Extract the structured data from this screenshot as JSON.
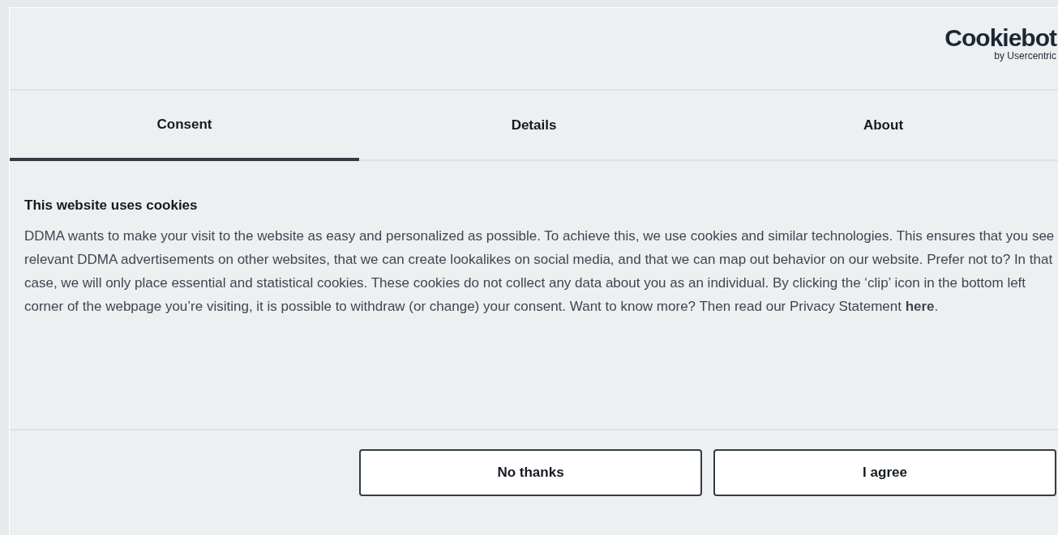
{
  "logo": {
    "name": "Cookiebot",
    "byline": "by Usercentric"
  },
  "tabs": [
    {
      "label": "Consent",
      "selected": true
    },
    {
      "label": "Details",
      "selected": false
    },
    {
      "label": "About",
      "selected": false
    }
  ],
  "content": {
    "title": "This website uses cookies",
    "body": "DDMA wants to make your visit to the website as easy and personalized as possible. To achieve this, we use cookies and similar technologies. This ensures that you see relevant DDMA advertisements on other websites, that we can create lookalikes on social media, and that we can map out behavior on our website. Prefer not to? In that case, we will only place essential and statistical cookies. These cookies do not collect any data about you as an individual. By clicking the ‘clip’ icon in the bottom left corner of the webpage you’re visiting, it is possible to withdraw (or change) your consent. Want to know more? Then read our Privacy Statement **here**."
  },
  "buttons": [
    "No thanks",
    "I agree"
  ]
}
